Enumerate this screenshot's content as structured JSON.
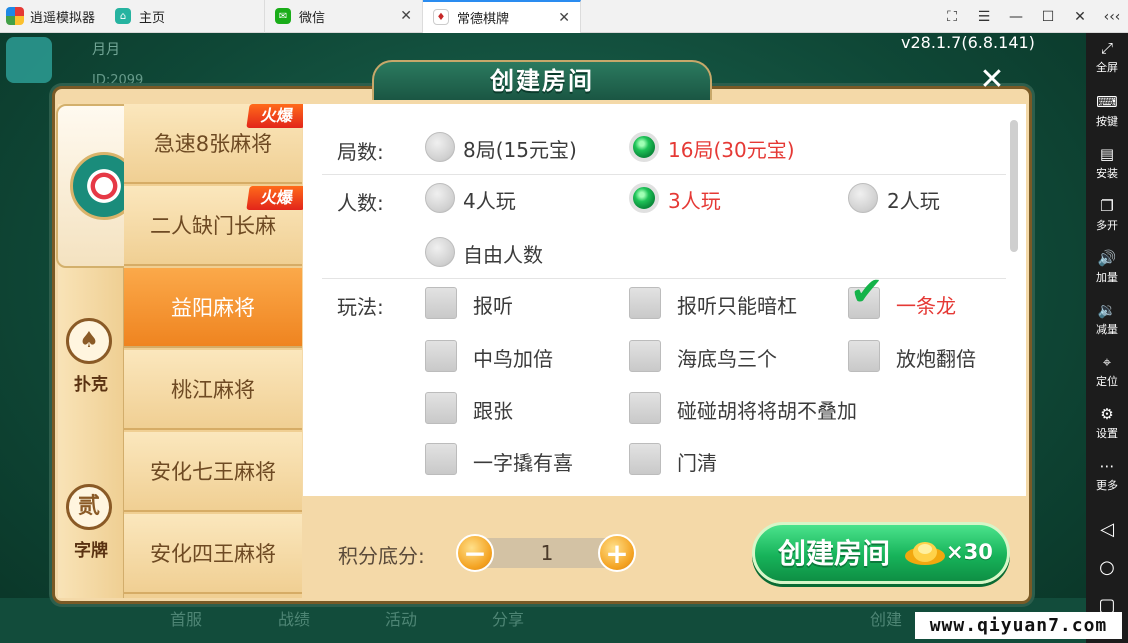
{
  "emulator": {
    "app_name": "逍遥模拟器",
    "tabs": [
      {
        "label": "主页"
      },
      {
        "label": "微信"
      },
      {
        "label": "常德棋牌"
      }
    ],
    "window_controls": [
      "⛶",
      "☰",
      "—",
      "☐",
      "✕",
      "‹‹‹"
    ],
    "sidebar": [
      {
        "label": "全屏",
        "icon": "fullscreen-icon",
        "glyph": "⤢"
      },
      {
        "label": "按键",
        "icon": "keyboard-icon",
        "glyph": "⌨"
      },
      {
        "label": "安装",
        "icon": "apk-icon",
        "glyph": "▤"
      },
      {
        "label": "多开",
        "icon": "multi-instance-icon",
        "glyph": "❐"
      },
      {
        "label": "加量",
        "icon": "volume-up-icon",
        "glyph": "🔊"
      },
      {
        "label": "减量",
        "icon": "volume-down-icon",
        "glyph": "🔉"
      },
      {
        "label": "定位",
        "icon": "location-icon",
        "glyph": "⌖"
      },
      {
        "label": "设置",
        "icon": "settings-icon",
        "glyph": "⚙"
      },
      {
        "label": "更多",
        "icon": "more-icon",
        "glyph": "⋯"
      }
    ]
  },
  "game": {
    "version": "v28.1.7(6.8.141)",
    "player_name": "月月",
    "player_id": "ID:2099",
    "bottom_menu": [
      "首服",
      "战绩",
      "活动",
      "分享",
      "创建"
    ]
  },
  "dialog": {
    "title": "创建房间",
    "close": "✕",
    "categories": [
      {
        "label": "扑克",
        "icon_glyph": "♠"
      },
      {
        "label": "字牌",
        "icon_glyph": "贰"
      }
    ],
    "games": [
      {
        "label": "急速8张麻将",
        "badge": "火爆"
      },
      {
        "label": "二人缺门长麻",
        "badge": "火爆"
      },
      {
        "label": "益阳麻将",
        "active": true
      },
      {
        "label": "桃江麻将"
      },
      {
        "label": "安化七王麻将"
      },
      {
        "label": "安化四王麻将"
      }
    ],
    "rounds": {
      "label": "局数:",
      "options": [
        {
          "label": "8局(15元宝)",
          "selected": false
        },
        {
          "label": "16局(30元宝)",
          "selected": true
        }
      ]
    },
    "players": {
      "label": "人数:",
      "options": [
        {
          "label": "4人玩",
          "selected": false
        },
        {
          "label": "3人玩",
          "selected": true
        },
        {
          "label": "2人玩",
          "selected": false
        },
        {
          "label": "自由人数",
          "selected": false
        }
      ]
    },
    "rules": {
      "label": "玩法:",
      "options": [
        {
          "label": "报听",
          "checked": false
        },
        {
          "label": "报听只能暗杠",
          "checked": false
        },
        {
          "label": "一条龙",
          "checked": true
        },
        {
          "label": "中鸟加倍",
          "checked": false
        },
        {
          "label": "海底鸟三个",
          "checked": false
        },
        {
          "label": "放炮翻倍",
          "checked": false
        },
        {
          "label": "跟张",
          "checked": false
        },
        {
          "label": "碰碰胡将将胡不叠加",
          "checked": false
        },
        {
          "label": "一字撬有喜",
          "checked": false
        },
        {
          "label": "门清",
          "checked": false
        }
      ]
    },
    "base_score": {
      "label": "积分底分:",
      "value": "1",
      "minus": "−",
      "plus": "+"
    },
    "create_button": {
      "label": "创建房间",
      "cost": "×30"
    }
  },
  "watermark": "www.qiyuan7.com",
  "colors": {
    "accent_green": "#17b35a",
    "selected_red": "#e53935",
    "active_tab_orange": "#ef8420",
    "hot_badge": "#e2251a"
  }
}
